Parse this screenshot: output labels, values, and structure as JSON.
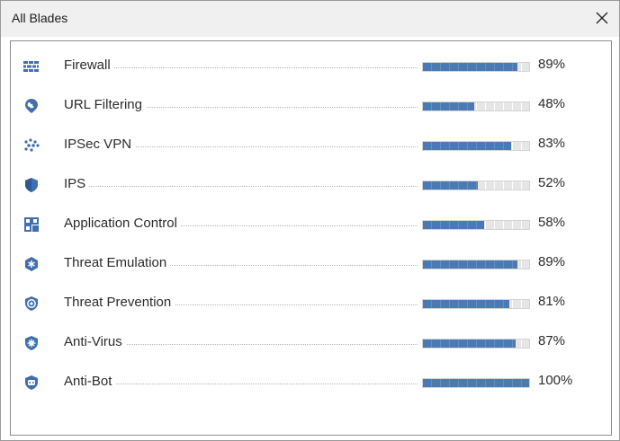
{
  "window": {
    "title": "All Blades"
  },
  "colors": {
    "accent": "#3f6fae",
    "bar_fill": "#4a7ab3",
    "bar_track": "#e6e6e6"
  },
  "blades": [
    {
      "name": "Firewall",
      "percent": 89,
      "percent_label": "89%",
      "icon": "firewall-icon"
    },
    {
      "name": "URL Filtering",
      "percent": 48,
      "percent_label": "48%",
      "icon": "globe-pin-icon"
    },
    {
      "name": "IPSec VPN",
      "percent": 83,
      "percent_label": "83%",
      "icon": "network-dots-icon"
    },
    {
      "name": "IPS",
      "percent": 52,
      "percent_label": "52%",
      "icon": "shield-icon"
    },
    {
      "name": "Application Control",
      "percent": 58,
      "percent_label": "58%",
      "icon": "app-grid-icon"
    },
    {
      "name": "Threat Emulation",
      "percent": 89,
      "percent_label": "89%",
      "icon": "hex-snowflake-icon"
    },
    {
      "name": "Threat Prevention",
      "percent": 81,
      "percent_label": "81%",
      "icon": "target-shield-icon"
    },
    {
      "name": "Anti-Virus",
      "percent": 87,
      "percent_label": "87%",
      "icon": "virus-shield-icon"
    },
    {
      "name": "Anti-Bot",
      "percent": 100,
      "percent_label": "100%",
      "icon": "bot-shield-icon"
    }
  ]
}
